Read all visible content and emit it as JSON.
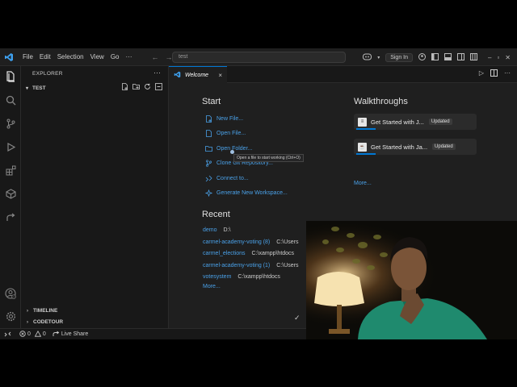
{
  "titlebar": {
    "menu": [
      "File",
      "Edit",
      "Selection",
      "View",
      "Go",
      "···"
    ],
    "search_value": "test",
    "signin_label": "Sign In"
  },
  "sidebar": {
    "header": "EXPLORER",
    "more": "···",
    "folder": "TEST",
    "sections": [
      "TIMELINE",
      "CODETOUR"
    ]
  },
  "tabs": [
    {
      "label": "Welcome",
      "close": "×"
    }
  ],
  "welcome": {
    "start_heading": "Start",
    "start_items": [
      {
        "label": "New File...",
        "icon": "new-file-icon"
      },
      {
        "label": "Open File...",
        "icon": "open-file-icon"
      },
      {
        "label": "Open Folder...",
        "icon": "open-folder-icon"
      },
      {
        "label": "Clone Git Repository...",
        "icon": "git-clone-icon"
      },
      {
        "label": "Connect to...",
        "icon": "remote-connect-icon"
      },
      {
        "label": "Generate New Workspace...",
        "icon": "sparkle-icon"
      }
    ],
    "tooltip": "Open a file to start working (Ctrl+O)",
    "recent_heading": "Recent",
    "recent": [
      {
        "name": "demo",
        "path": "D:\\"
      },
      {
        "name": "carmel-academy-voting (8)",
        "path": "C:\\Users"
      },
      {
        "name": "carmel_elections",
        "path": "C:\\xampp\\htdocs"
      },
      {
        "name": "carmel-academy-voting (1)",
        "path": "C:\\Users"
      },
      {
        "name": "votesystem",
        "path": "C:\\xampp\\htdocs"
      }
    ],
    "recent_more": "More...",
    "walkthroughs_heading": "Walkthroughs",
    "walkthroughs": [
      {
        "title": "Get Started with J...",
        "badge": "Updated"
      },
      {
        "title": "Get Started with Ja...",
        "badge": "Updated"
      }
    ],
    "walkthroughs_more": "More..."
  },
  "statusbar": {
    "errors": "0",
    "warnings": "0",
    "live_share": "Live Share"
  },
  "colors": {
    "accent": "#0078d4",
    "link": "#4aa1e8",
    "background": "#1f1f1f",
    "sidebar": "#181818"
  }
}
